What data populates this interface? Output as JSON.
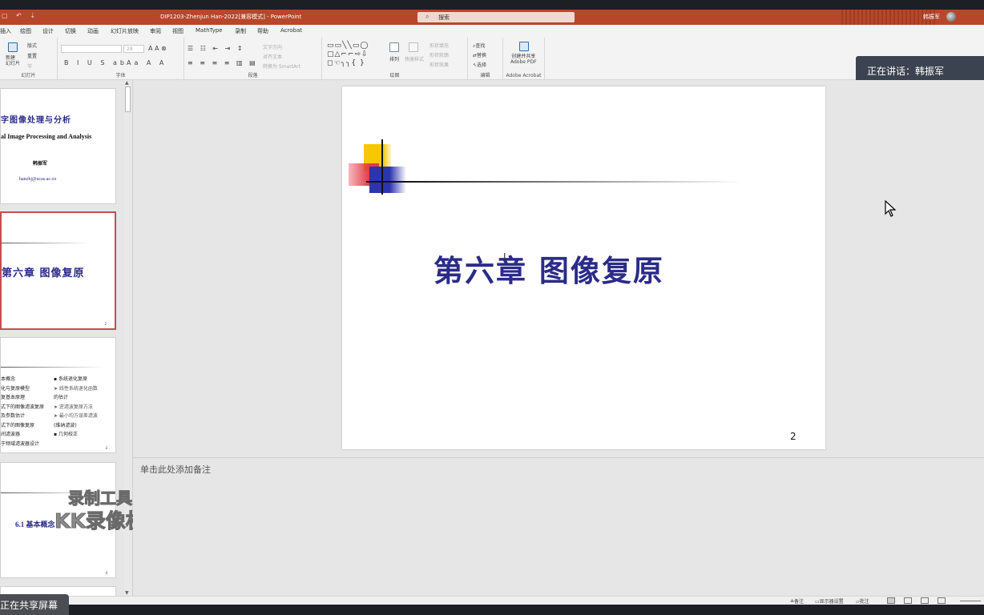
{
  "titlebar": {
    "doc_title": "DIP1203-Zhenjun Han-2022[兼容模式]  -  PowerPoint",
    "search_placeholder": "搜索",
    "user": "韩振军"
  },
  "tabs": [
    "插入",
    "绘图",
    "设计",
    "切换",
    "动画",
    "幻灯片放映",
    "审阅",
    "视图",
    "MathType",
    "录制",
    "帮助",
    "Acrobat"
  ],
  "ribbon": {
    "new_slide": "新建\n幻灯片",
    "layout": "版式",
    "reset": "重置",
    "section": "节",
    "group_slides": "幻灯片",
    "group_font": "字体",
    "group_paragraph": "段落",
    "text_direction": "文字方向",
    "align_text": "对齐文本",
    "smartart": "转换为 SmartArt",
    "group_drawing": "绘图",
    "arrange": "排列",
    "quick_styles": "快速样式",
    "shape_fill": "形状填充",
    "shape_outline": "形状轮廓",
    "shape_effects": "形状效果",
    "find": "查找",
    "replace": "替换",
    "select": "选择",
    "group_editing": "编辑",
    "create_pdf": "创建并共享\nAdobe PDF",
    "group_acrobat": "Adobe Acrobat",
    "font_size": "28"
  },
  "speaker_notice": "正在讲话：韩振军",
  "thumbnails": {
    "s1_title": "字图像处理与分析",
    "s1_subtitle": "al Image Processing and Analysis",
    "s1_author": "韩振军",
    "s1_email": "hanzhj@ucas.ac.cn",
    "s2_title": "第六章 图像复原",
    "s2_num": "2",
    "s3_left": [
      "本概念",
      "化与复原模型",
      "复基本原理",
      "式下的图像滤波复原",
      "及参数估计",
      "式下的图像复原",
      "间滤波器",
      "于频域滤波器设计"
    ],
    "s3_right": [
      "▪ 系统退化复原",
      "➤ 线性系统退化函数",
      "   的估计",
      "➤ 逆滤波复原方法",
      "➤ 最小均方误差滤波",
      "   (维纳滤波)",
      "▪ 几何校正"
    ],
    "s3_num": "3",
    "s4_title": "6.1  基本概念",
    "s4_num": "4"
  },
  "watermark": {
    "line1": "录制工具",
    "line2": "KK录像机"
  },
  "slide": {
    "title": "第六章 图像复原",
    "number": "2"
  },
  "notes": {
    "placeholder": "单击此处添加备注"
  },
  "statusbar": {
    "notes": "备注",
    "display_settings": "显示器设置",
    "comments": "批注"
  },
  "sharing": "正在共享屏幕",
  "colors": {
    "accent": "#b7472a",
    "title_blue": "#2b2b88",
    "selected_border": "#c0504d"
  }
}
